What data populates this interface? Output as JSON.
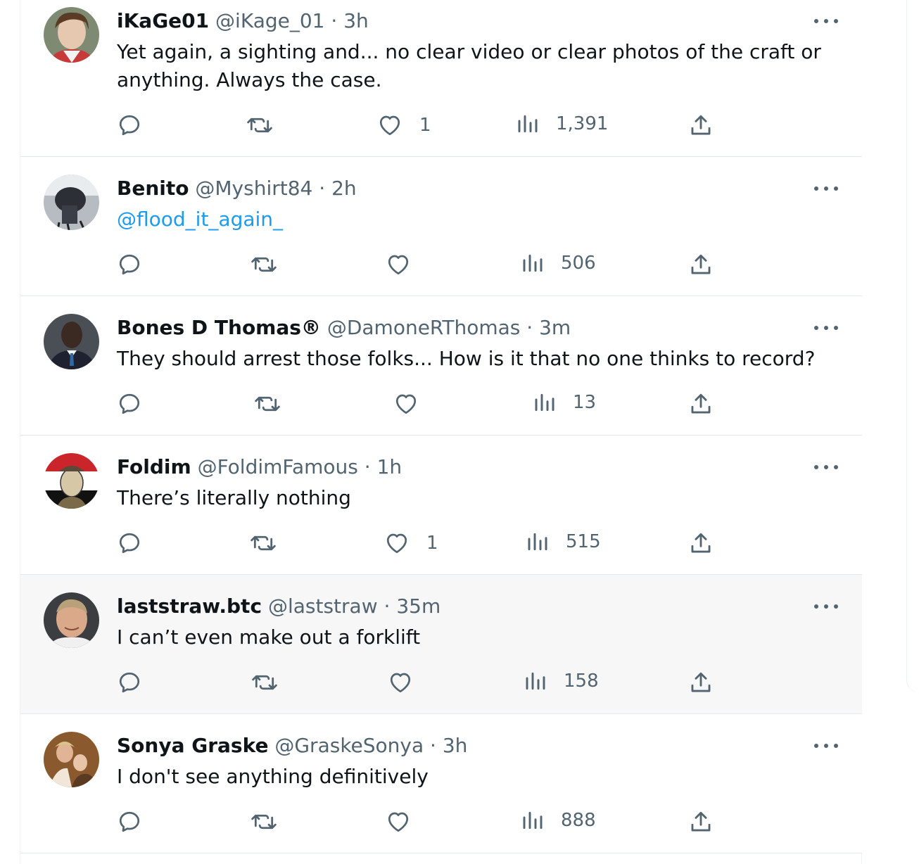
{
  "tweets": [
    {
      "name": "iKaGe01",
      "handle": "@iKage_01",
      "time": "3h",
      "text": "Yet again, a sighting and... no clear video or clear photos of the craft or anything. Always the case.",
      "likes": "1",
      "views": "1,391"
    },
    {
      "name": "Benito",
      "handle": "@Myshirt84",
      "time": "2h",
      "text": "@flood_it_again_",
      "likes": "",
      "views": "506"
    },
    {
      "name": "Bones D Thomas®",
      "handle": "@DamoneRThomas",
      "time": "3m",
      "text": "They should arrest those folks... How is it that no one thinks to record?",
      "likes": "",
      "views": "13"
    },
    {
      "name": "Foldim",
      "handle": "@FoldimFamous",
      "time": "1h",
      "text": "There’s literally nothing",
      "likes": "1",
      "views": "515"
    },
    {
      "name": "laststraw.btc",
      "handle": "@laststraw",
      "time": "35m",
      "text": "I can’t even make out a forklift",
      "likes": "",
      "views": "158"
    },
    {
      "name": "Sonya Graske",
      "handle": "@GraskeSonya",
      "time": "3h",
      "text": "I don't see anything definitively",
      "likes": "",
      "views": "888"
    }
  ],
  "separator": "·",
  "icons": {
    "reply": "reply-icon",
    "retweet": "retweet-icon",
    "like": "heart-icon",
    "views": "views-icon",
    "share": "share-icon",
    "more": "more-icon"
  },
  "colors": {
    "text": "#0f1419",
    "muted": "#536471",
    "link": "#1d9bf0",
    "hover": "#f7f7f7"
  }
}
